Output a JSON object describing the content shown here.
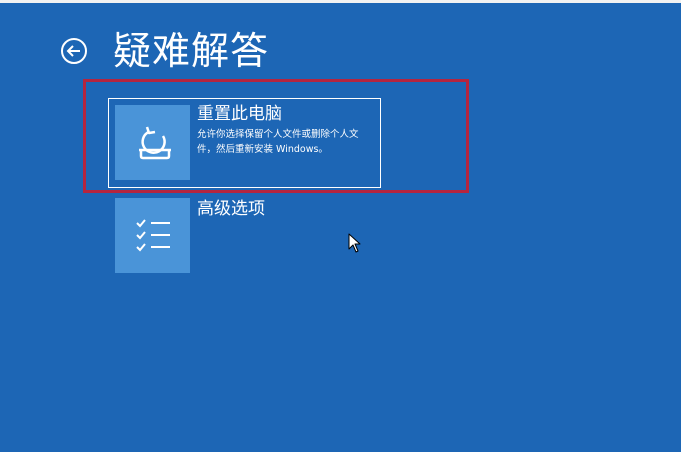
{
  "page": {
    "title": "疑难解答",
    "background_color": "#1d66b5",
    "highlight_color": "#b5253f"
  },
  "back_button": {
    "icon": "arrow-left-circle-icon"
  },
  "options": [
    {
      "icon": "reset-pc-icon",
      "title": "重置此电脑",
      "description": "允许你选择保留个人文件或删除个人文件，然后重新安装 Windows。",
      "selected": true
    },
    {
      "icon": "checklist-icon",
      "title": "高级选项",
      "description": "",
      "selected": false
    }
  ]
}
